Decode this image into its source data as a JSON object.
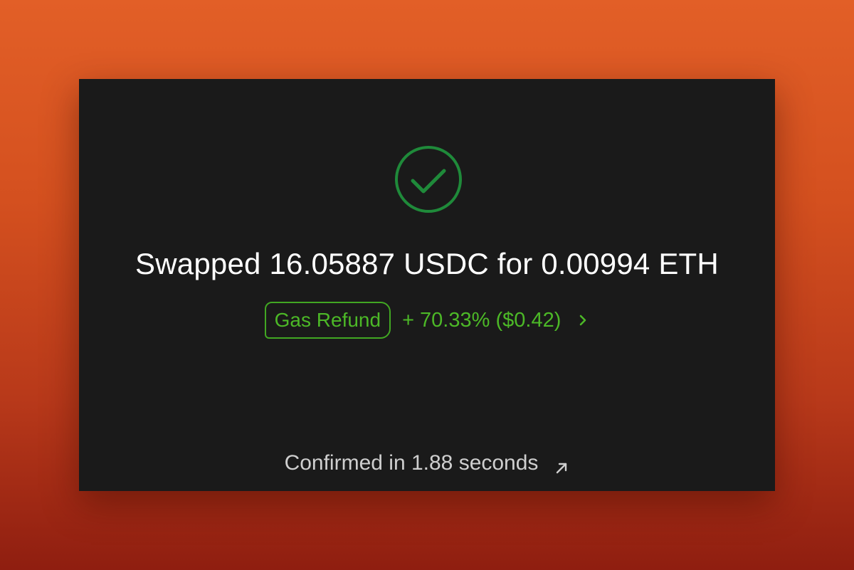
{
  "status": {
    "title": "Swapped 16.05887 USDC for 0.00994 ETH",
    "icon": "check-circle-icon",
    "color": "#1f8a3a"
  },
  "gas_refund": {
    "badge_label": "Gas Refund",
    "amount_text": "+ 70.33% ($0.42)",
    "accent_color": "#4cb827",
    "icon": "chevron-right-icon"
  },
  "footer": {
    "confirmation_text": "Confirmed in 1.88 seconds",
    "icon": "external-link-arrow-icon"
  }
}
